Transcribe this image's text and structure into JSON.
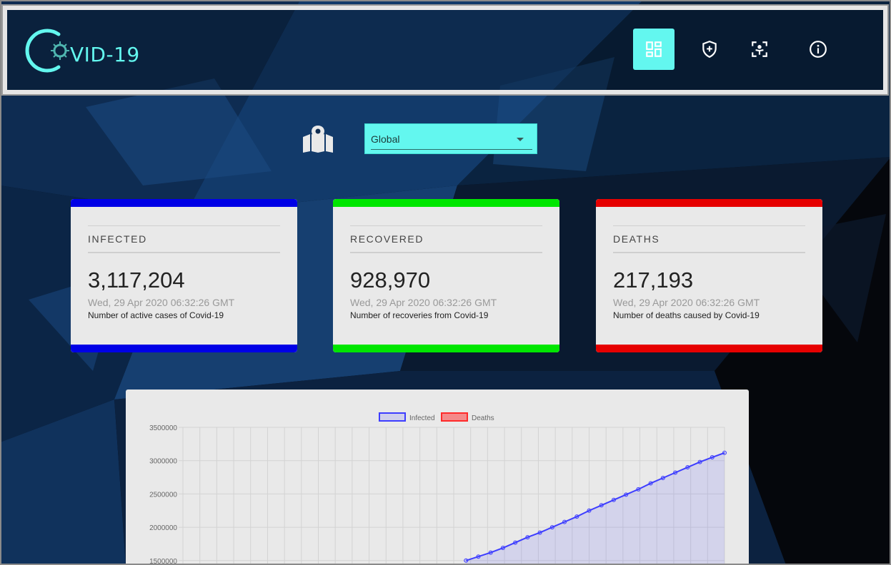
{
  "app": {
    "logo_text": "VID-19",
    "brand_color": "#63f7ef"
  },
  "nav": {
    "items": [
      {
        "icon": "dashboard-icon",
        "active": true
      },
      {
        "icon": "shield-plus-icon",
        "active": false
      },
      {
        "icon": "scan-person-icon",
        "active": false
      },
      {
        "icon": "info-icon",
        "active": false
      }
    ]
  },
  "region": {
    "icon": "map-icon",
    "selected": "Global"
  },
  "cards": [
    {
      "title": "INFECTED",
      "value": "3,117,204",
      "date": "Wed, 29 Apr 2020 06:32:26 GMT",
      "desc": "Number of active cases of Covid-19",
      "color": "#0000e6"
    },
    {
      "title": "RECOVERED",
      "value": "928,970",
      "date": "Wed, 29 Apr 2020 06:32:26 GMT",
      "desc": "Number of recoveries from Covid-19",
      "color": "#00e600"
    },
    {
      "title": "DEATHS",
      "value": "217,193",
      "date": "Wed, 29 Apr 2020 06:32:26 GMT",
      "desc": "Number of deaths caused by Covid-19",
      "color": "#e60000"
    }
  ],
  "chart_data": {
    "type": "line",
    "legend": [
      {
        "name": "Infected",
        "color": "#3d3dff"
      },
      {
        "name": "Deaths",
        "color": "#ff2a2a"
      }
    ],
    "legend_placement": "top",
    "grid": true,
    "y_ticks": [
      "3500000",
      "3000000",
      "2500000",
      "2000000",
      "1500000"
    ],
    "ylim": [
      1500000,
      3500000
    ],
    "x_count": 33,
    "series": [
      {
        "name": "Infected",
        "values": [
          null,
          null,
          null,
          null,
          null,
          null,
          null,
          null,
          null,
          null,
          null,
          null,
          null,
          null,
          null,
          null,
          null,
          null,
          null,
          null,
          null,
          null,
          null,
          1500000,
          1560000,
          1620000,
          1690000,
          1770000,
          1850000,
          1920000,
          2000000,
          2080000,
          2160000,
          2250000,
          2330000,
          2410000,
          2490000,
          2570000,
          2660000,
          2740000,
          2820000,
          2900000,
          2980000,
          3050000,
          3117204
        ]
      }
    ]
  }
}
